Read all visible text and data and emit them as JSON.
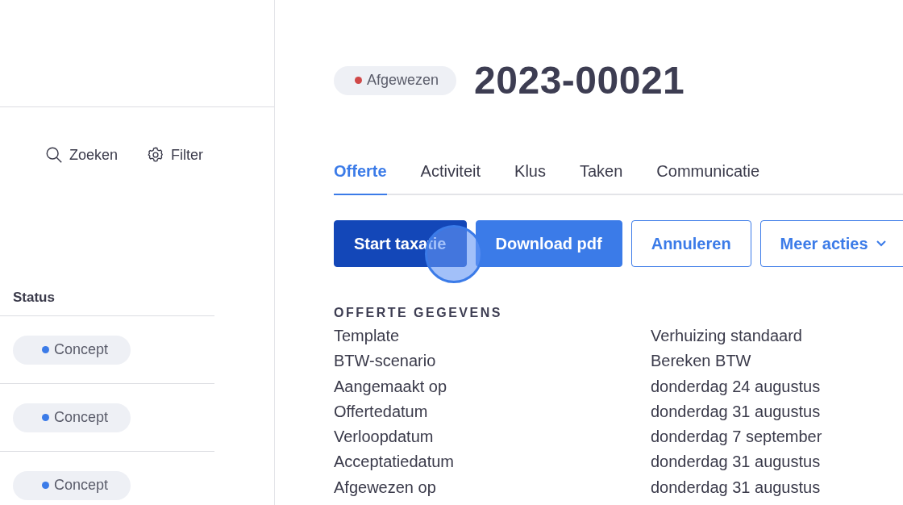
{
  "sidebar": {
    "toolbar": [
      {
        "kind": "search",
        "label": "Zoeken"
      },
      {
        "kind": "filter",
        "label": "Filter"
      }
    ],
    "table": {
      "columns": [
        "Status"
      ],
      "rows": [
        {
          "status": "Concept",
          "color": "#3b7be8"
        },
        {
          "status": "Concept",
          "color": "#3b7be8"
        },
        {
          "status": "Concept",
          "color": "#3b7be8"
        }
      ]
    }
  },
  "header": {
    "status": {
      "label": "Afgewezen",
      "color": "#d04848"
    },
    "title": "2023-00021"
  },
  "tabs": [
    {
      "label": "Offerte",
      "selected": true
    },
    {
      "label": "Activiteit",
      "selected": false
    },
    {
      "label": "Klus",
      "selected": false
    },
    {
      "label": "Taken",
      "selected": false
    },
    {
      "label": "Communicatie",
      "selected": false
    }
  ],
  "actions": [
    {
      "label": "Start taxatie",
      "kind": "primary"
    },
    {
      "label": "Download pdf",
      "kind": "secondary"
    },
    {
      "label": "Annuleren",
      "kind": "outline"
    },
    {
      "label": "Meer acties",
      "kind": "dropdown"
    }
  ],
  "details": {
    "title": "OFFERTE GEGEVENS",
    "rows": [
      {
        "label": "Template",
        "value": "Verhuizing standaard"
      },
      {
        "label": "BTW-scenario",
        "value": "Bereken BTW"
      },
      {
        "label": "Aangemaakt op",
        "value": "donderdag 24 augustus"
      },
      {
        "label": "Offertedatum",
        "value": "donderdag 31 augustus"
      },
      {
        "label": "Verloopdatum",
        "value": "donderdag 7 september"
      },
      {
        "label": "Acceptatiedatum",
        "value": "donderdag 31 augustus"
      },
      {
        "label": "Afgewezen op",
        "value": "donderdag 31 augustus"
      }
    ]
  }
}
